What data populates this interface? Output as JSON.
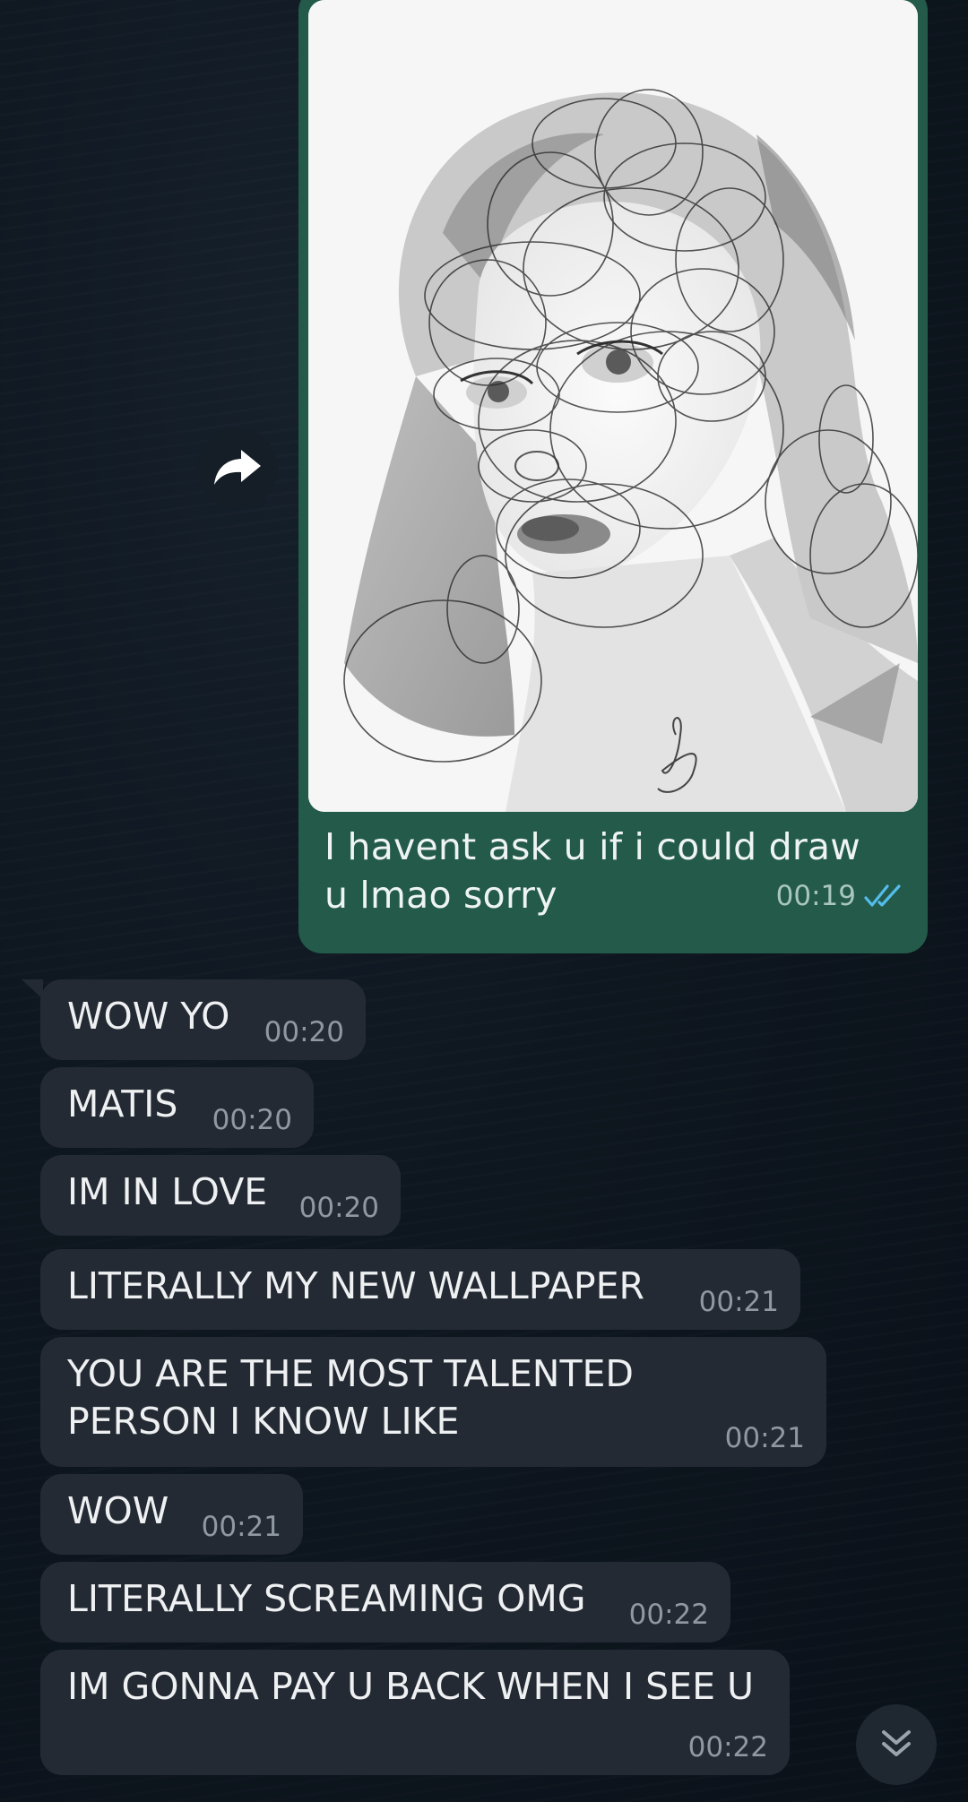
{
  "outgoing_message": {
    "caption": "I havent ask u if i could draw u lmao sorry",
    "time": "00:19",
    "status_icon": "double-check-read-icon",
    "media_description_icon": "drawing-image"
  },
  "incoming_messages": [
    {
      "text": "WOW YO",
      "time": "00:20"
    },
    {
      "text": "MATIS",
      "time": "00:20"
    },
    {
      "text": "IM IN LOVE",
      "time": "00:20"
    },
    {
      "text": "LITERALLY MY NEW WALLPAPER",
      "time": "00:21"
    },
    {
      "text": "YOU ARE THE MOST TALENTED",
      "text2": "PERSON I KNOW LIKE",
      "time": "00:21"
    },
    {
      "text": "WOW",
      "time": "00:21"
    },
    {
      "text": "LITERALLY SCREAMING OMG",
      "time": "00:22"
    },
    {
      "text": "IM GONNA PAY U BACK WHEN I SEE U",
      "time": "00:22"
    }
  ],
  "controls": {
    "forward_icon": "forward-arrow-icon",
    "scroll_icon": "double-chevron-down-icon"
  },
  "colors": {
    "outgoing_bubble": "#235a4a",
    "incoming_bubble": "#232a33",
    "read_tick": "#53bdeb"
  }
}
